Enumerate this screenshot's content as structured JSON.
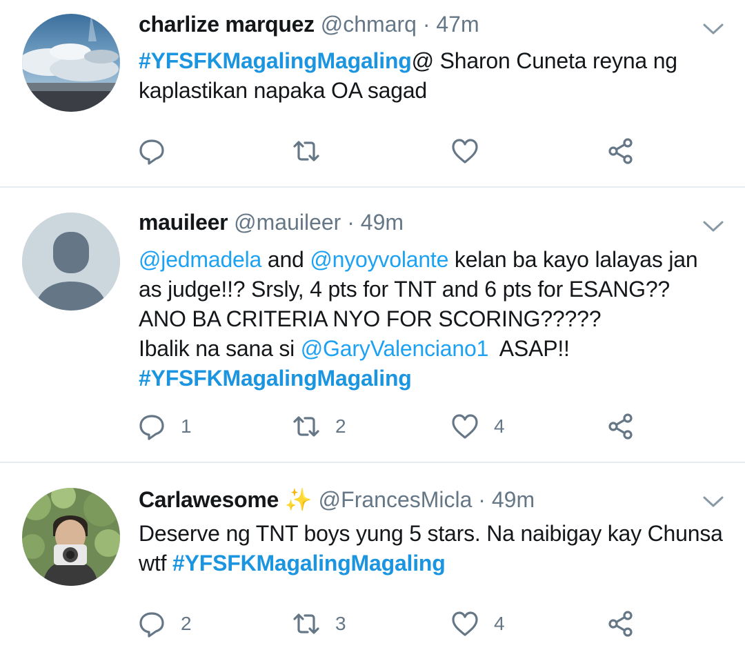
{
  "tweets": [
    {
      "name": "charlize marquez",
      "handle": "@chmarq",
      "sep": "·",
      "time": "47m",
      "body": [
        {
          "text": "#YFSFKMagalingMagaling",
          "kind": "hashtag"
        },
        {
          "text": "@ Sharon Cuneta reyna ng kaplastikan napaka OA sagad",
          "kind": "text"
        }
      ],
      "counts": {
        "reply": "",
        "retweet": "",
        "like": ""
      }
    },
    {
      "name": "mauileer",
      "handle": "@mauileer",
      "sep": "·",
      "time": "49m",
      "lines": [
        [
          {
            "text": "@jedmadela",
            "kind": "link"
          },
          {
            "text": " and ",
            "kind": "text"
          },
          {
            "text": "@nyoyvolante",
            "kind": "link"
          },
          {
            "text": " kelan ba kayo lalayas jan as judge!!? Srsly, 4 pts for TNT and 6 pts for ESANG??",
            "kind": "text"
          }
        ],
        [
          {
            "text": "ANO BA CRITERIA NYO FOR SCORING?????",
            "kind": "text"
          }
        ],
        [
          {
            "text": "Ibalik na sana si ",
            "kind": "text"
          },
          {
            "text": "@GaryValenciano1",
            "kind": "link"
          },
          {
            "text": "  ASAP!!",
            "kind": "text"
          }
        ],
        [
          {
            "text": "#YFSFKMagalingMagaling",
            "kind": "hashtag"
          }
        ]
      ],
      "counts": {
        "reply": "1",
        "retweet": "2",
        "like": "4"
      }
    },
    {
      "name": "Carlawesome",
      "name_emoji": "✨",
      "handle": "@FrancesMicla",
      "sep": "·",
      "time": "49m",
      "body": [
        {
          "text": "Deserve ng TNT boys yung 5 stars. Na naibigay kay Chunsa wtf ",
          "kind": "text"
        },
        {
          "text": "#YFSFKMagalingMagaling",
          "kind": "hashtag"
        }
      ],
      "counts": {
        "reply": "2",
        "retweet": "3",
        "like": "4"
      }
    }
  ],
  "icons": {
    "reply": "reply-icon",
    "retweet": "retweet-icon",
    "like": "like-icon",
    "share": "share-icon",
    "menu": "chevron-down-icon"
  },
  "colors": {
    "link": "#1da1f2",
    "hashtag": "#1b95e0",
    "muted": "#657786",
    "divider": "#e6ecf0"
  }
}
